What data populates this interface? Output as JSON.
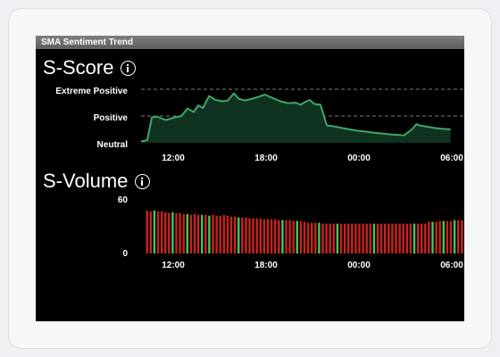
{
  "widget": {
    "title": "SMA Sentiment Trend"
  },
  "score": {
    "title": "S-Score",
    "y_labels": [
      "Extreme Positive",
      "Positive",
      "Neutral"
    ],
    "x_labels": [
      "12:00",
      "18:00",
      "00:00",
      "06:00"
    ]
  },
  "volume": {
    "title": "S-Volume",
    "y_labels": [
      "60",
      "0"
    ],
    "x_labels": [
      "12:00",
      "18:00",
      "00:00",
      "06:00"
    ]
  },
  "colors": {
    "score_line": "#3fa66a",
    "score_fill": "#0f3320",
    "bar_negative": "#c8231e",
    "bar_positive": "#47c759",
    "grid": "#7a7a7a"
  },
  "chart_data": [
    {
      "type": "area",
      "name": "S-Score",
      "ylabels": [
        "Neutral",
        "Positive",
        "Extreme Positive"
      ],
      "ylim": [
        0,
        2
      ],
      "xticks": [
        "12:00",
        "18:00",
        "00:00",
        "06:00"
      ],
      "x_hours": [
        0,
        0.4,
        0.7,
        1.0,
        1.6,
        2.2,
        2.6,
        3.0,
        3.4,
        3.7,
        4.0,
        4.4,
        4.8,
        5.3,
        5.6,
        6.0,
        6.3,
        6.7,
        7.2,
        7.6,
        8.0,
        8.4,
        9.0,
        9.5,
        10.0,
        10.3,
        10.6,
        10.9,
        11.2,
        11.6,
        12.0,
        12.6,
        13.0,
        13.5,
        14.0,
        14.5,
        15.0,
        15.5,
        16.0,
        16.5,
        17.0,
        17.5,
        17.8,
        18.0,
        18.5,
        19.0,
        19.5,
        20.0
      ],
      "values": [
        0.05,
        0.1,
        0.95,
        0.98,
        0.85,
        0.95,
        1.0,
        1.28,
        1.15,
        1.4,
        1.3,
        1.75,
        1.6,
        1.55,
        1.58,
        1.85,
        1.65,
        1.58,
        1.65,
        1.72,
        1.8,
        1.7,
        1.55,
        1.48,
        1.5,
        1.42,
        1.52,
        1.6,
        1.45,
        1.42,
        0.65,
        0.6,
        0.55,
        0.5,
        0.45,
        0.42,
        0.38,
        0.35,
        0.32,
        0.3,
        0.28,
        0.5,
        0.7,
        0.65,
        0.6,
        0.55,
        0.52,
        0.5
      ]
    },
    {
      "type": "bar",
      "name": "S-Volume",
      "ylim": [
        0,
        60
      ],
      "xticks": [
        "12:00",
        "18:00",
        "00:00",
        "06:00"
      ],
      "values": [
        49,
        48,
        49,
        48,
        48,
        47,
        46,
        47,
        46,
        46,
        45,
        45,
        44,
        45,
        44,
        44,
        44,
        43,
        44,
        43,
        43,
        44,
        43,
        42,
        42,
        41,
        41,
        41,
        40,
        40,
        40,
        40,
        39,
        39,
        39,
        39,
        38,
        38,
        38,
        38,
        37,
        37,
        37,
        36,
        35,
        35,
        35,
        35,
        34,
        34,
        34,
        34,
        34,
        34,
        34,
        34,
        34,
        34,
        34,
        34,
        34,
        34,
        34,
        34,
        34,
        34,
        34,
        34,
        34,
        34,
        34,
        34,
        34,
        34,
        34,
        34,
        34,
        36,
        36,
        36,
        37,
        37,
        37,
        37,
        38,
        38,
        38,
        38,
        39
      ],
      "positive_indices": [
        2,
        7,
        11,
        15,
        17,
        25,
        37,
        41,
        47,
        52,
        62,
        73,
        78,
        81,
        84
      ]
    }
  ]
}
